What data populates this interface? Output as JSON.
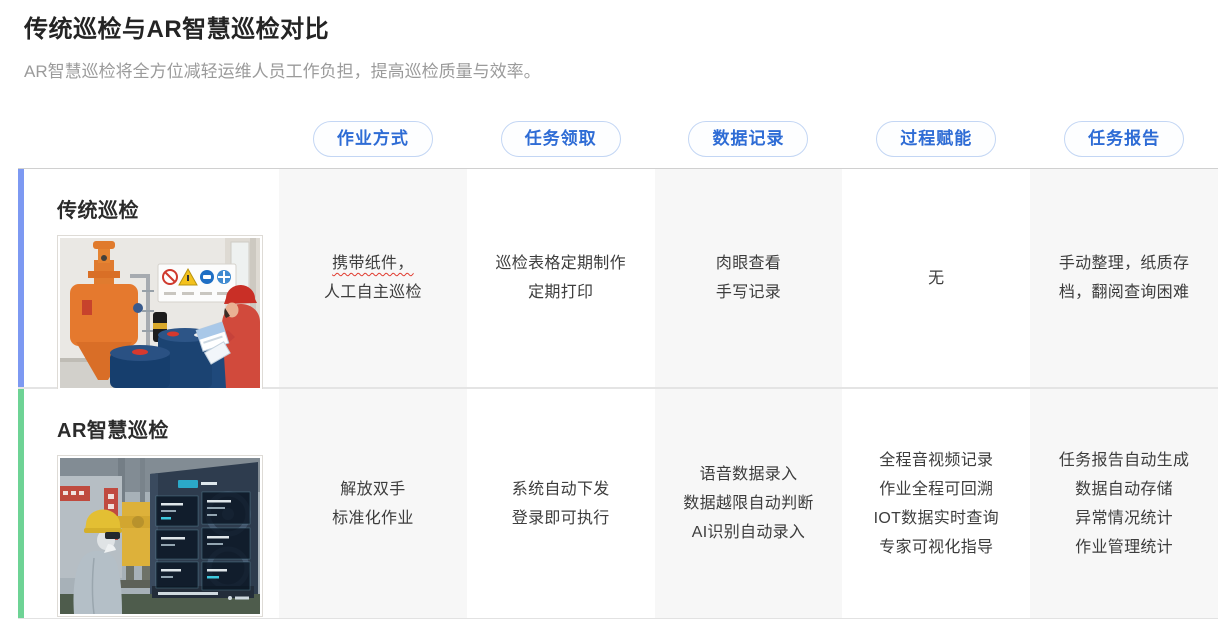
{
  "page": {
    "title": "传统巡检与AR智慧巡检对比",
    "subtitle": "AR智慧巡检将全方位减轻运维人员工作负担，提高巡检质量与效率。"
  },
  "columns": [
    "作业方式",
    "任务领取",
    "数据记录",
    "过程赋能",
    "任务报告"
  ],
  "rows": [
    {
      "label": "传统巡检",
      "accent_color": "#7d99f2",
      "photo": "worker-with-paper-checklist-photo",
      "cells": [
        [
          "携带纸件，",
          "人工自主巡检"
        ],
        [
          "巡检表格定期制作",
          "定期打印"
        ],
        [
          "肉眼查看",
          "手写记录"
        ],
        [
          "无"
        ],
        [
          "手动整理，纸质存",
          "档，翻阅查询困难"
        ]
      ]
    },
    {
      "label": "AR智慧巡检",
      "accent_color": "#6ed395",
      "photo": "worker-with-ar-headset-screen-photo",
      "cells": [
        [
          "解放双手",
          "标准化作业"
        ],
        [
          "系统自动下发",
          "登录即可执行"
        ],
        [
          "语音数据录入",
          "数据越限自动判断",
          "AI识别自动录入"
        ],
        [
          "全程音视频记录",
          "作业全程可回溯",
          "IOT数据实时查询",
          "专家可视化指导"
        ],
        [
          "任务报告自动生成",
          "数据自动存储",
          "异常情况统计",
          "作业管理统计"
        ]
      ]
    }
  ],
  "colors": {
    "pill_text": "#2e6cd5",
    "pill_border": "#c3d6f4",
    "column_shade": "#f7f7f7",
    "accent_blue": "#7d99f2",
    "accent_green": "#6ed395",
    "subtitle_gray": "#9b9b9b"
  }
}
